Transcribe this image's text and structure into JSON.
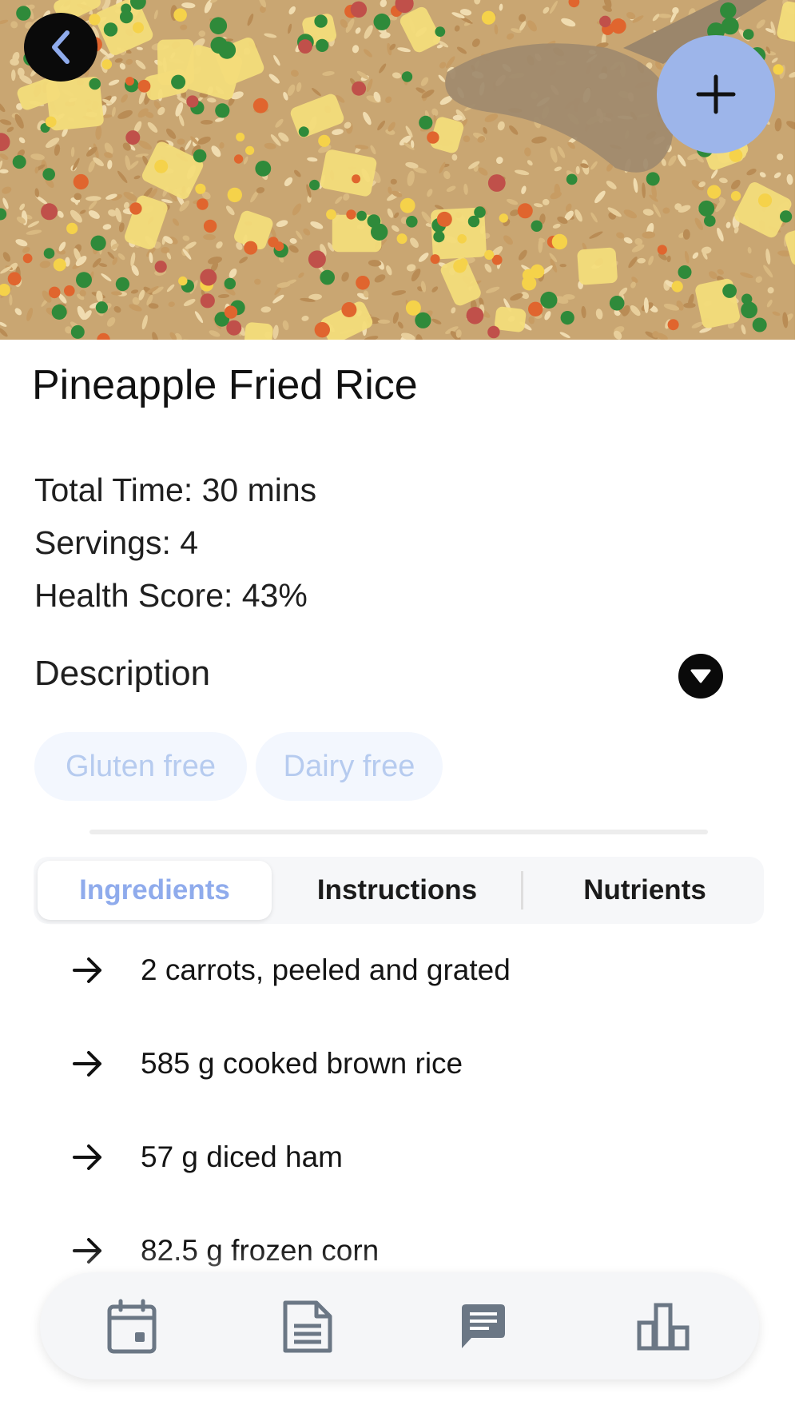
{
  "recipe": {
    "title": "Pineapple Fried Rice",
    "total_time": "Total Time: 30 mins",
    "servings": "Servings: 4",
    "health_score": "Health Score: 43%",
    "description_label": "Description",
    "tags": [
      "Gluten free",
      "Dairy free"
    ]
  },
  "tabs": [
    {
      "label": "Ingredients",
      "active": true
    },
    {
      "label": "Instructions",
      "active": false
    },
    {
      "label": "Nutrients",
      "active": false
    }
  ],
  "ingredients": [
    "2 carrots, peeled and grated",
    "585 g cooked brown rice",
    "57 g diced ham",
    "82.5 g frozen corn"
  ],
  "icons": {
    "back": "chevron-left-icon",
    "add": "plus-icon",
    "description_toggle": "caret-down-icon",
    "ingredient_bullet": "arrow-right-icon",
    "nav": [
      "calendar-icon",
      "document-icon",
      "chat-icon",
      "bar-chart-icon"
    ]
  },
  "colors": {
    "accent": "#8fabec",
    "fab": "#9db5ea",
    "tag_bg": "#f3f7fe",
    "tag_text": "#b6cbef",
    "icon_gray": "#6b7785"
  }
}
